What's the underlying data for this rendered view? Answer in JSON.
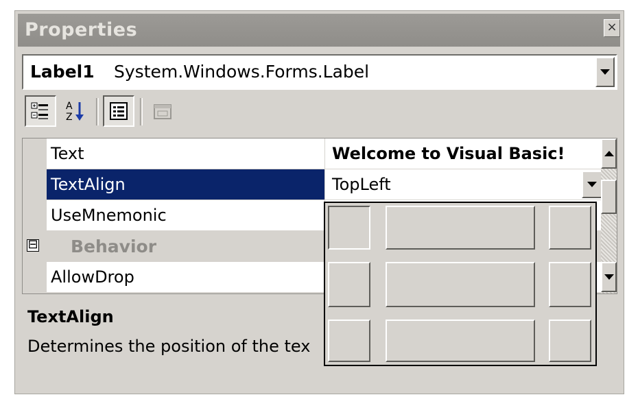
{
  "window": {
    "title": "Properties",
    "close_symbol": "×"
  },
  "object_selector": {
    "name": "Label1",
    "type": "System.Windows.Forms.Label"
  },
  "toolbar": {
    "buttons": [
      {
        "name": "categorized-button",
        "icon": "categorized-icon",
        "pressed": true
      },
      {
        "name": "alphabetical-button",
        "icon": "alphabetical-icon",
        "pressed": false
      },
      {
        "name": "properties-button",
        "icon": "properties-icon",
        "pressed": true
      },
      {
        "name": "property-pages-button",
        "icon": "property-pages-icon",
        "pressed": false
      }
    ]
  },
  "grid": {
    "rows": [
      {
        "kind": "property",
        "name": "Text",
        "value": "Welcome to Visual Basic!",
        "value_bold": true
      },
      {
        "kind": "property",
        "name": "TextAlign",
        "value": "TopLeft",
        "selected": true
      },
      {
        "kind": "property",
        "name": "UseMnemonic",
        "value": ""
      },
      {
        "kind": "category",
        "name": "Behavior",
        "collapse_symbol": "⊟"
      },
      {
        "kind": "property",
        "name": "AllowDrop",
        "value": ""
      }
    ]
  },
  "alignment_popup": {
    "options": [
      {
        "name": "TopLeft",
        "selected": true
      },
      {
        "name": "TopCenter"
      },
      {
        "name": "TopRight"
      },
      {
        "name": "MiddleLeft"
      },
      {
        "name": "MiddleCenter"
      },
      {
        "name": "MiddleRight"
      },
      {
        "name": "BottomLeft"
      },
      {
        "name": "BottomCenter"
      },
      {
        "name": "BottomRight"
      }
    ]
  },
  "description": {
    "title": "TextAlign",
    "text": "Determines the position of the tex"
  },
  "colors": {
    "selection": "#0a246a",
    "face": "#d6d3ce",
    "titlebar": "#8f8d89"
  }
}
